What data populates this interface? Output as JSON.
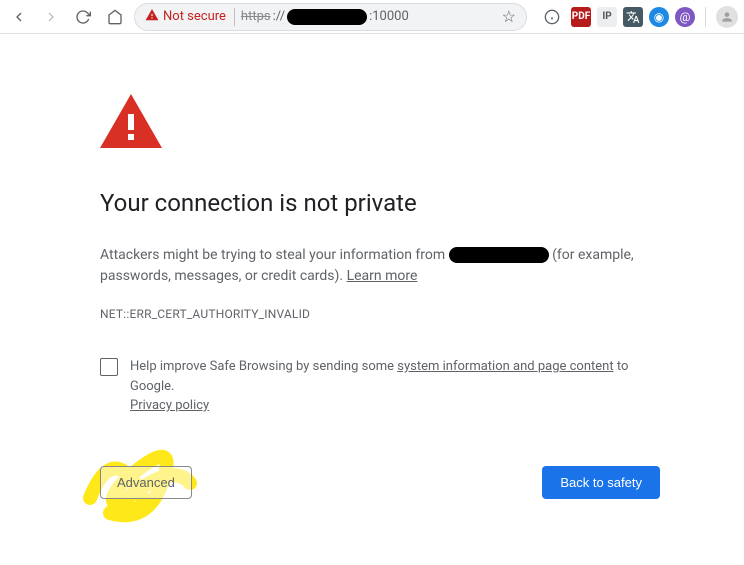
{
  "toolbar": {
    "not_secure_label": "Not secure",
    "url_scheme": "https",
    "url_sep": "://",
    "url_port": ":10000"
  },
  "page": {
    "headline": "Your connection is not private",
    "body_prefix": "Attackers might be trying to steal your information from",
    "body_suffix": "(for example, passwords, messages, or credit cards).",
    "learn_more": "Learn more",
    "error_code": "NET::ERR_CERT_AUTHORITY_INVALID",
    "optin_prefix": "Help improve Safe Browsing by sending some",
    "optin_link": "system information and page content",
    "optin_suffix": "to Google.",
    "privacy_policy": "Privacy policy",
    "advanced_btn": "Advanced",
    "back_btn": "Back to safety"
  }
}
